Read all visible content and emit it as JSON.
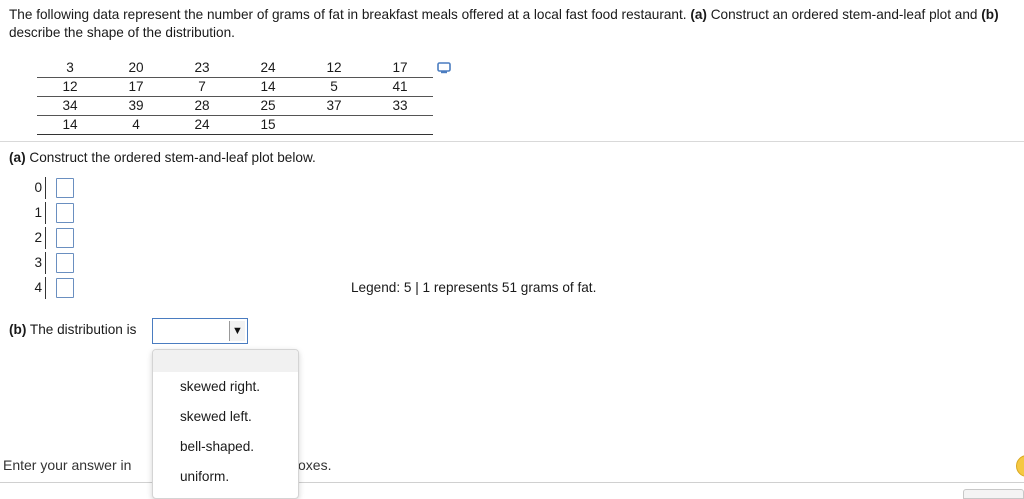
{
  "question": {
    "intro": "The following data represent the number of grams of fat in breakfast meals offered at a local fast food restaurant.",
    "part_a_tag": "(a)",
    "part_a_text": "Construct an ordered stem-and-leaf plot",
    "and": "and",
    "part_b_tag": "(b)",
    "part_b_text": "describe the shape of the distribution."
  },
  "data_table": {
    "rows": [
      [
        "3",
        "20",
        "23",
        "24",
        "12",
        "17"
      ],
      [
        "12",
        "17",
        "7",
        "14",
        "5",
        "41"
      ],
      [
        "34",
        "39",
        "28",
        "25",
        "37",
        "33"
      ],
      [
        "14",
        "4",
        "24",
        "15",
        "",
        ""
      ]
    ]
  },
  "icons": {
    "copy": "copy-data-icon"
  },
  "part_a": {
    "tag": "(a)",
    "text": "Construct the ordered stem-and-leaf plot below.",
    "stems": [
      "0",
      "1",
      "2",
      "3",
      "4"
    ]
  },
  "legend": "Legend: 5 | 1 represents 51 grams of fat.",
  "part_b": {
    "tag": "(b)",
    "text": "The distribution is",
    "selected": "",
    "options": [
      "skewed right.",
      "skewed left.",
      "bell-shaped.",
      "uniform."
    ]
  },
  "footer": {
    "visible_left": "Enter your answer in",
    "visible_right": "oxes."
  }
}
